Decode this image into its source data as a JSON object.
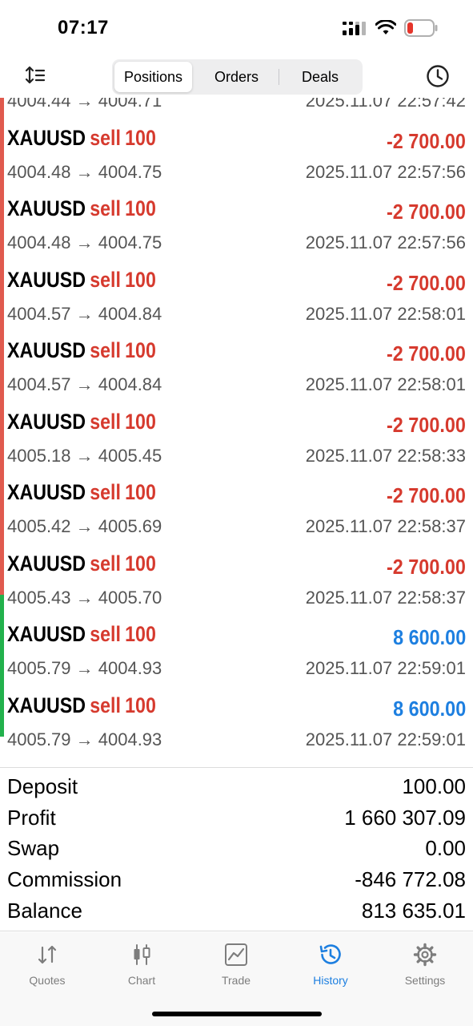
{
  "status_bar": {
    "time": "07:17"
  },
  "top_nav": {
    "segments": [
      "Positions",
      "Orders",
      "Deals"
    ],
    "active_segment": "Positions"
  },
  "partial_row": {
    "prices": "4004.44 → 4004.71",
    "time": "2025.11.07 22:57:42"
  },
  "deals": [
    {
      "symbol": "XAUUSD",
      "direction": "sell",
      "volume": "100",
      "profit": "-2 700.00",
      "prices": "4004.48 → 4004.75",
      "time": "2025.11.07 22:57:56",
      "result": "loss"
    },
    {
      "symbol": "XAUUSD",
      "direction": "sell",
      "volume": "100",
      "profit": "-2 700.00",
      "prices": "4004.48 → 4004.75",
      "time": "2025.11.07 22:57:56",
      "result": "loss"
    },
    {
      "symbol": "XAUUSD",
      "direction": "sell",
      "volume": "100",
      "profit": "-2 700.00",
      "prices": "4004.57 → 4004.84",
      "time": "2025.11.07 22:58:01",
      "result": "loss"
    },
    {
      "symbol": "XAUUSD",
      "direction": "sell",
      "volume": "100",
      "profit": "-2 700.00",
      "prices": "4004.57 → 4004.84",
      "time": "2025.11.07 22:58:01",
      "result": "loss"
    },
    {
      "symbol": "XAUUSD",
      "direction": "sell",
      "volume": "100",
      "profit": "-2 700.00",
      "prices": "4005.18 → 4005.45",
      "time": "2025.11.07 22:58:33",
      "result": "loss"
    },
    {
      "symbol": "XAUUSD",
      "direction": "sell",
      "volume": "100",
      "profit": "-2 700.00",
      "prices": "4005.42 → 4005.69",
      "time": "2025.11.07 22:58:37",
      "result": "loss"
    },
    {
      "symbol": "XAUUSD",
      "direction": "sell",
      "volume": "100",
      "profit": "-2 700.00",
      "prices": "4005.43 → 4005.70",
      "time": "2025.11.07 22:58:37",
      "result": "loss"
    },
    {
      "symbol": "XAUUSD",
      "direction": "sell",
      "volume": "100",
      "profit": "8 600.00",
      "prices": "4005.79 → 4004.93",
      "time": "2025.11.07 22:59:01",
      "result": "win"
    },
    {
      "symbol": "XAUUSD",
      "direction": "sell",
      "volume": "100",
      "profit": "8 600.00",
      "prices": "4005.79 → 4004.93",
      "time": "2025.11.07 22:59:01",
      "result": "win"
    }
  ],
  "summary": [
    {
      "label": "Deposit",
      "value": "100.00"
    },
    {
      "label": "Profit",
      "value": "1 660 307.09"
    },
    {
      "label": "Swap",
      "value": "0.00"
    },
    {
      "label": "Commission",
      "value": "-846 772.08"
    },
    {
      "label": "Balance",
      "value": "813 635.01"
    }
  ],
  "tab_bar": {
    "tabs": [
      {
        "label": "Quotes",
        "icon": "quotes-icon"
      },
      {
        "label": "Chart",
        "icon": "chart-icon"
      },
      {
        "label": "Trade",
        "icon": "trade-icon"
      },
      {
        "label": "History",
        "icon": "history-icon"
      },
      {
        "label": "Settings",
        "icon": "settings-icon"
      }
    ],
    "active_tab": "History"
  },
  "colors": {
    "loss": "#d63a2e",
    "win": "#1d7fe0",
    "loss_bar": "#e05a4e",
    "win_bar": "#22b14c",
    "accent": "#1d7fe0"
  }
}
